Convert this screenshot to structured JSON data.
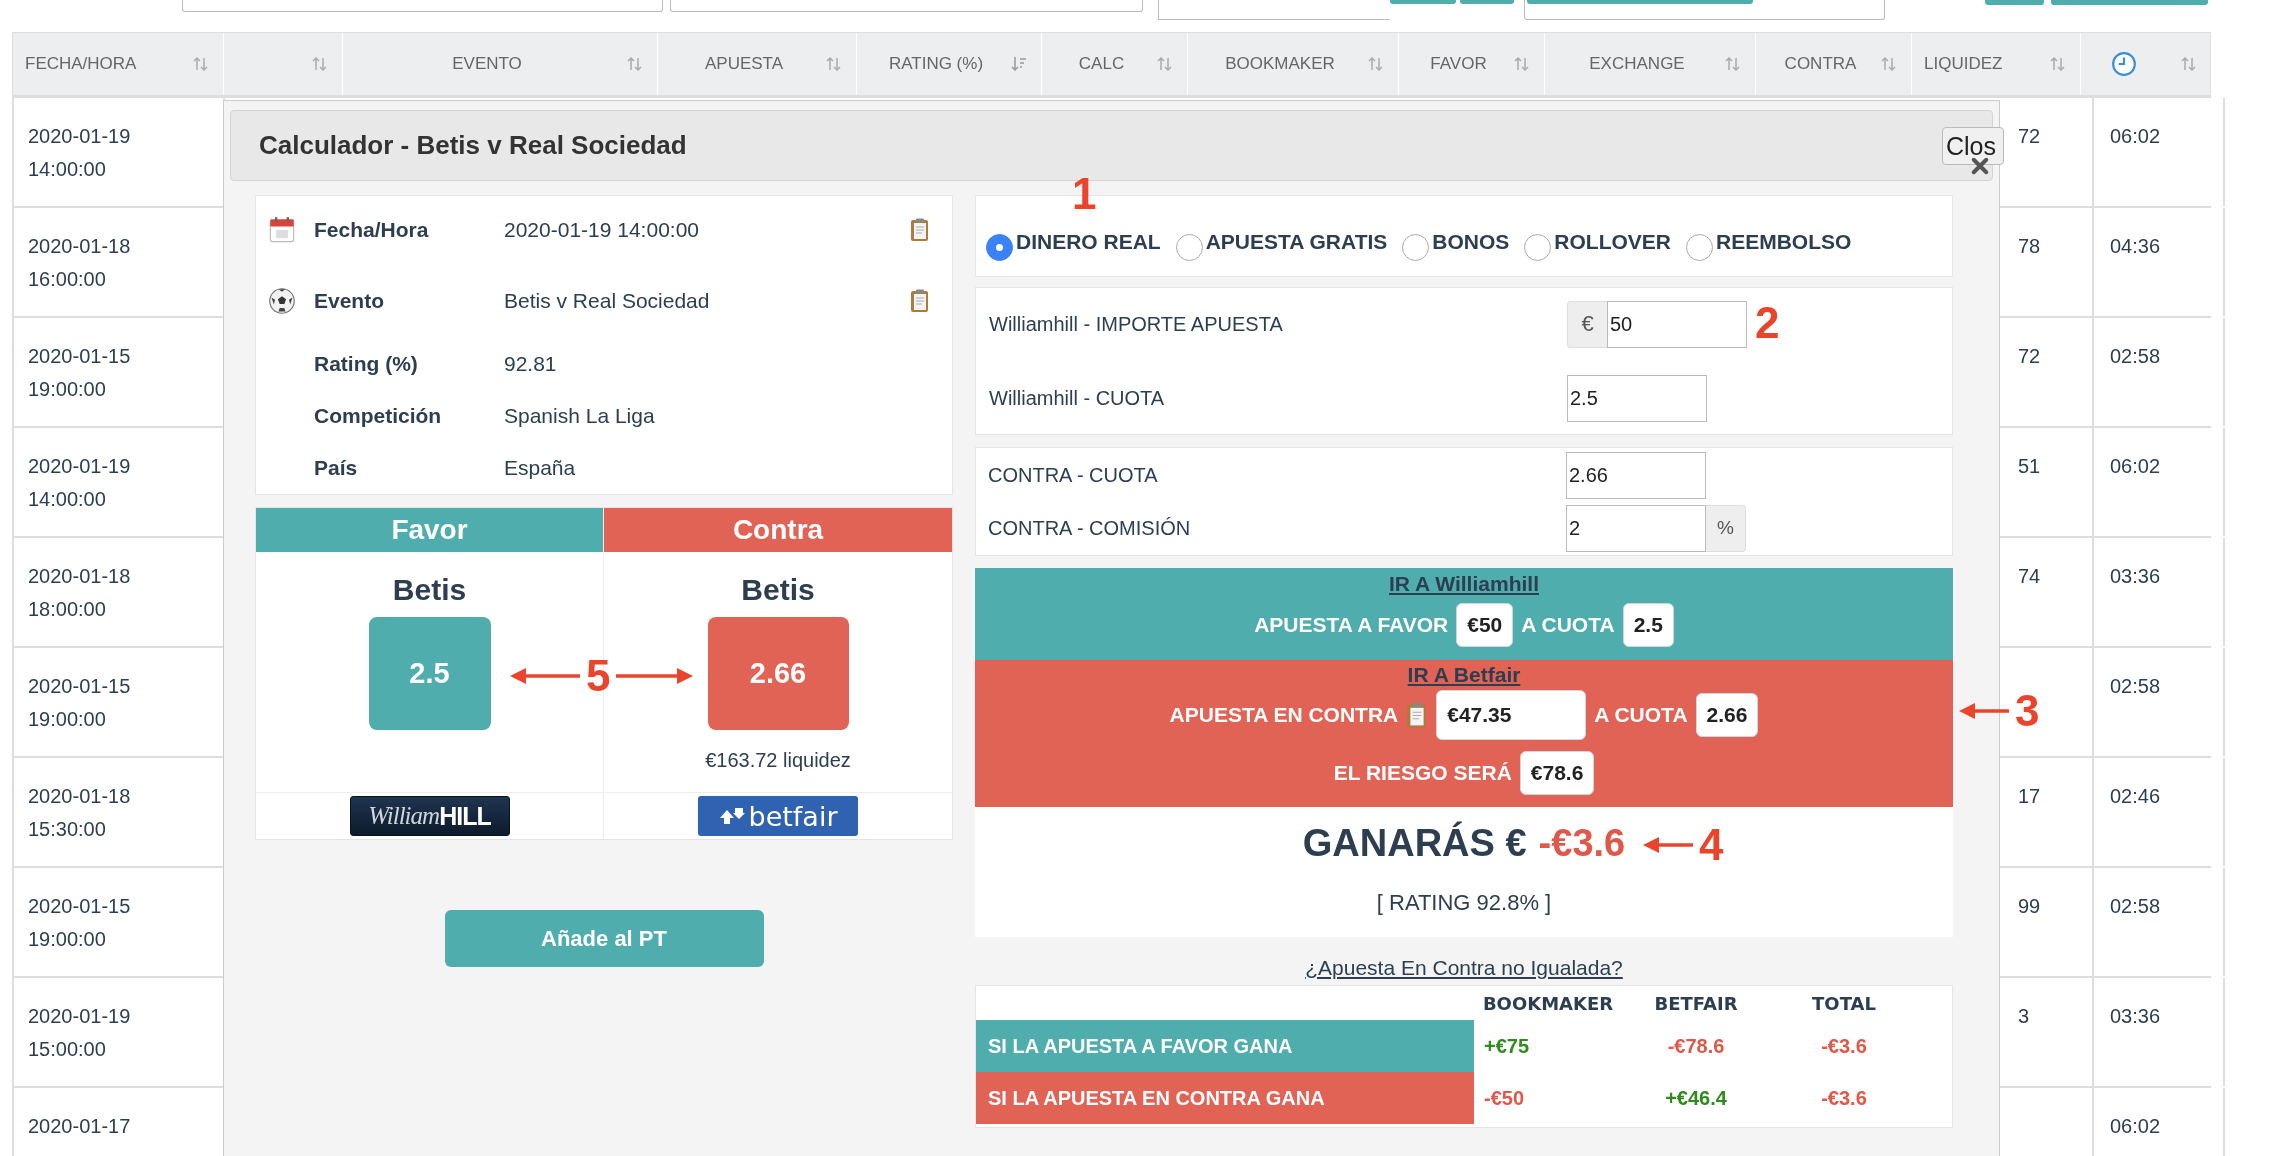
{
  "table": {
    "columns": [
      {
        "label": "FECHA/HORA",
        "sorted": false
      },
      {
        "sorted": false
      },
      {
        "label": "EVENTO",
        "sorted": false
      },
      {
        "label": "APUESTA",
        "sorted": false
      },
      {
        "label": "RATING (%)",
        "sorted": true
      },
      {
        "label": "CALC",
        "sorted": false
      },
      {
        "label": "BOOKMAKER",
        "sorted": false
      },
      {
        "label": "FAVOR",
        "sorted": false
      },
      {
        "label": "EXCHANGE",
        "sorted": false
      },
      {
        "label": "CONTRA",
        "sorted": false
      },
      {
        "label": "LIQUIDEZ",
        "sorted": false
      },
      {
        "kind": "clock",
        "sorted": false
      }
    ],
    "rows": [
      {
        "date": "2020-01-19",
        "hour": "14:00:00",
        "liquidez": "72",
        "elapsed": "06:02"
      },
      {
        "date": "2020-01-18",
        "hour": "16:00:00",
        "liquidez": "78",
        "elapsed": "04:36"
      },
      {
        "date": "2020-01-15",
        "hour": "19:00:00",
        "liquidez": "72",
        "elapsed": "02:58"
      },
      {
        "date": "2020-01-19",
        "hour": "14:00:00",
        "liquidez": "51",
        "elapsed": "06:02"
      },
      {
        "date": "2020-01-18",
        "hour": "18:00:00",
        "liquidez": "74",
        "elapsed": "03:36"
      },
      {
        "date": "2020-01-15",
        "hour": "19:00:00",
        "elapsed": "02:58"
      },
      {
        "date": "2020-01-18",
        "hour": "15:30:00",
        "liquidez": "17",
        "elapsed": "02:46"
      },
      {
        "date": "2020-01-15",
        "hour": "19:00:00",
        "liquidez": "99",
        "elapsed": "02:58"
      },
      {
        "date": "2020-01-19",
        "hour": "15:00:00",
        "liquidez": "3",
        "elapsed": "03:36"
      },
      {
        "date": "2020-01-17",
        "elapsed": "06:02"
      }
    ]
  },
  "modal": {
    "title": "Calculador - Betis v Real Sociedad",
    "close": "Clos",
    "details": [
      {
        "kind": "calendar",
        "label": "Fecha/Hora",
        "value": "2020-01-19 14:00:00",
        "copy": true
      },
      {
        "kind": "ball",
        "label": "Evento",
        "value": "Betis v Real Sociedad",
        "copy": true
      },
      {
        "kind": "plain",
        "label": "Rating (%)",
        "value": "92.81",
        "copy": false
      },
      {
        "kind": "plain",
        "label": "Competición",
        "value": "Spanish La Liga",
        "copy": false
      },
      {
        "kind": "plain",
        "label": "País",
        "value": "España",
        "copy": false
      }
    ],
    "comparison": [
      {
        "kind": "favor",
        "title": "Favor",
        "selection": "Betis",
        "odds": "2.5",
        "logo": {
          "script": "William",
          "bold": "HILL"
        }
      },
      {
        "kind": "contra",
        "title": "Contra",
        "selection": "Betis",
        "odds": "2.66",
        "liquidity": "€163.72 liquidez",
        "logo": {
          "text": "betfair"
        }
      }
    ],
    "add_button": "Añade al PT",
    "bet_types": [
      {
        "label": "DINERO REAL",
        "selected": true
      },
      {
        "label": "APUESTA GRATIS",
        "selected": false
      },
      {
        "label": "BONOS",
        "selected": false
      },
      {
        "label": "ROLLOVER",
        "selected": false
      },
      {
        "label": "REEMBOLSO",
        "selected": false
      }
    ],
    "back_fields": [
      {
        "label": "Williamhill - IMPORTE APUESTA",
        "prefix": "€",
        "value": "50"
      },
      {
        "label": "Williamhill - CUOTA",
        "value": "2.5"
      }
    ],
    "lay_fields": [
      {
        "label": "CONTRA - CUOTA",
        "value": "2.66"
      },
      {
        "label": "CONTRA - COMISIÓN",
        "value": "2",
        "suffix": "%"
      }
    ],
    "favor_bet": {
      "link": "IR A Williamhill",
      "label": "APUESTA A FAVOR",
      "stake": "€50",
      "odds_label": "A CUOTA",
      "odds": "2.5"
    },
    "lay_bet": {
      "link": "IR A Betfair",
      "label": "APUESTA EN CONTRA",
      "stake": "€47.35",
      "odds_label": "A CUOTA",
      "odds": "2.66",
      "risk_label": "EL RIESGO SERÁ",
      "risk": "€78.6"
    },
    "result": {
      "label": "GANARÁS €",
      "value": "-€3.6",
      "gain": false,
      "rating": "[ RATING 92.8% ]"
    },
    "unmatched_link": "¿Apuesta En Contra no Igualada?",
    "outcomes": {
      "columns": [
        "BOOKMAKER",
        "BETFAIR",
        "TOTAL"
      ],
      "rows": [
        {
          "kind": "favor",
          "label": "SI LA APUESTA A FAVOR GANA",
          "values": [
            {
              "text": "+€75",
              "gain": true
            },
            {
              "text": "-€78.6",
              "gain": false
            },
            {
              "text": "-€3.6",
              "gain": false
            }
          ]
        },
        {
          "kind": "contra",
          "label": "SI LA APUESTA EN CONTRA GANA",
          "values": [
            {
              "text": "-€50",
              "gain": false
            },
            {
              "text": "+€46.4",
              "gain": true
            },
            {
              "text": "-€3.6",
              "gain": false
            }
          ]
        }
      ]
    }
  },
  "annotations": [
    {
      "kind": "number",
      "label": "1"
    },
    {
      "kind": "number",
      "label": "2"
    },
    {
      "kind": "left-arrow",
      "label": "3"
    },
    {
      "kind": "left-arrow",
      "label": "4"
    },
    {
      "kind": "double-arrow",
      "label": "5"
    }
  ]
}
